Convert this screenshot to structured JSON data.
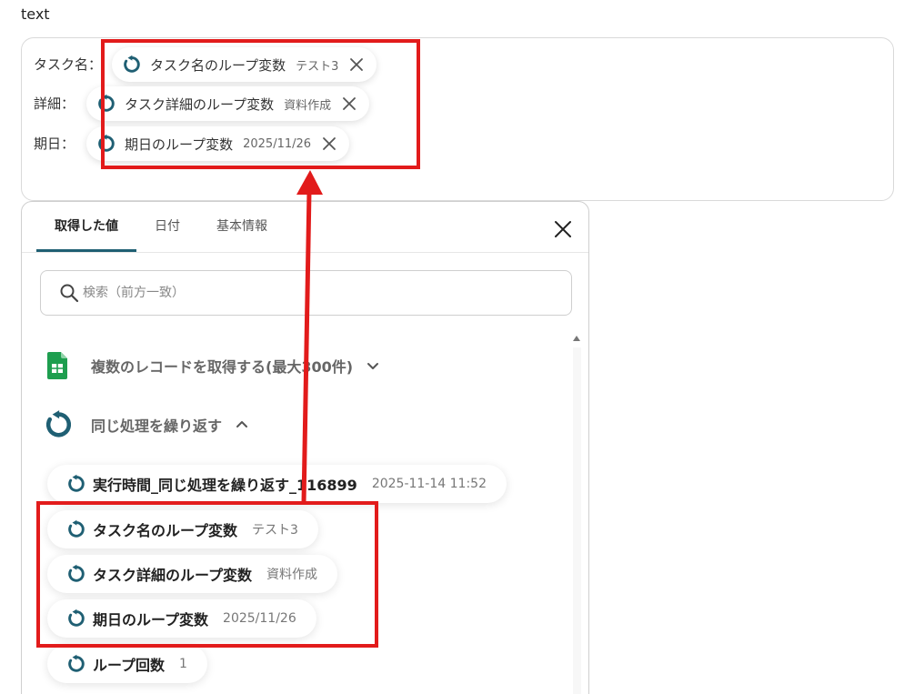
{
  "field_label": "text",
  "editor": {
    "lines": [
      {
        "label": "タスク名：",
        "chip": {
          "label": "タスク名のループ変数",
          "value": "テスト3"
        }
      },
      {
        "label": "詳細：",
        "chip": {
          "label": "タスク詳細のループ変数",
          "value": "資料作成"
        }
      },
      {
        "label": "期日：",
        "chip": {
          "label": "期日のループ変数",
          "value": "2025/11/26"
        }
      }
    ]
  },
  "panel": {
    "tabs": [
      {
        "label": "取得した値"
      },
      {
        "label": "日付"
      },
      {
        "label": "基本情報"
      }
    ],
    "search": {
      "placeholder": "検索（前方一致）",
      "value": ""
    },
    "groups": [
      {
        "label": "複数のレコードを取得する(最大300件)",
        "icon": "sheets-icon",
        "state": "collapsed"
      },
      {
        "label": "同じ処理を繰り返す",
        "icon": "loop-icon",
        "state": "expanded"
      }
    ],
    "items": [
      {
        "label": "実行時間_同じ処理を繰り返す_116899",
        "value": "2025-11-14 11:52"
      },
      {
        "label": "タスク名のループ変数",
        "value": "テスト3"
      },
      {
        "label": "タスク詳細のループ変数",
        "value": "資料作成"
      },
      {
        "label": "期日のループ変数",
        "value": "2025/11/26"
      },
      {
        "label": "ループ回数",
        "value": "1"
      }
    ]
  },
  "colors": {
    "accent": "#1f5f73",
    "highlight": "#e21b1b",
    "sheets_green": "#1e9e4f"
  }
}
